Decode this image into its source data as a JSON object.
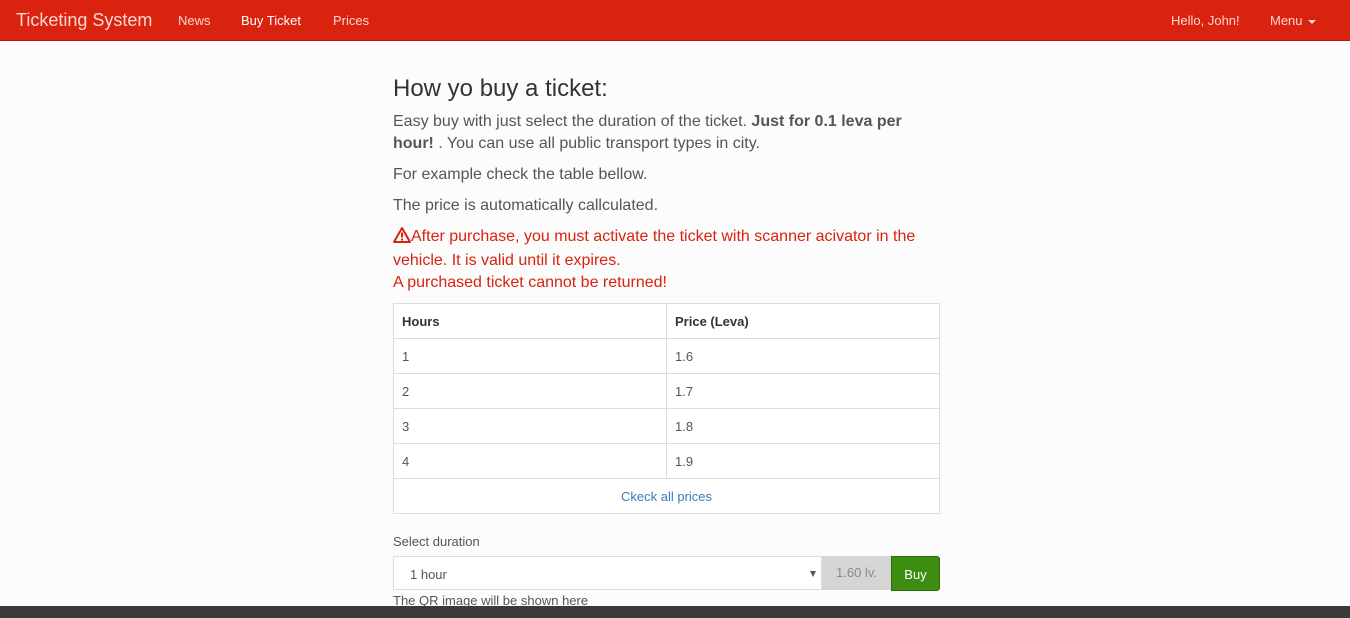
{
  "navbar": {
    "brand": "Ticketing System",
    "links": [
      "News",
      "Buy Ticket",
      "Prices"
    ],
    "greeting": "Hello, John!",
    "menu_label": "Menu"
  },
  "main": {
    "heading": "How yo buy a ticket:",
    "intro_text": "Easy buy with just select the duration of the ticket.",
    "intro_bold": "Just for 0.1 leva per hour!",
    "intro_tail": ". You can use all public transport types in city.",
    "example_text": "For example check the table bellow.",
    "auto_text": "The price is automatically callculated.",
    "warning_line1": "After purchase, you must activate the ticket with scanner acivator in the vehicle. It is valid until it expires.",
    "warning_line2": "A purchased ticket cannot be returned!"
  },
  "table": {
    "headers": [
      "Hours",
      "Price (Leva)"
    ],
    "rows": [
      [
        "1",
        "1.6"
      ],
      [
        "2",
        "1.7"
      ],
      [
        "3",
        "1.8"
      ],
      [
        "4",
        "1.9"
      ]
    ],
    "all_prices_link": "Ckeck all prices"
  },
  "form": {
    "select_label": "Select duration",
    "selected_value": "1 hour",
    "price_value": "1.60 lv.",
    "buy_label": "Buy",
    "qr_text": "The QR image will be shown here"
  },
  "colors": {
    "navbar": "#d9230f",
    "warning": "#d9230f",
    "buy_button": "#3d8d10",
    "link": "#3b7ab8"
  }
}
